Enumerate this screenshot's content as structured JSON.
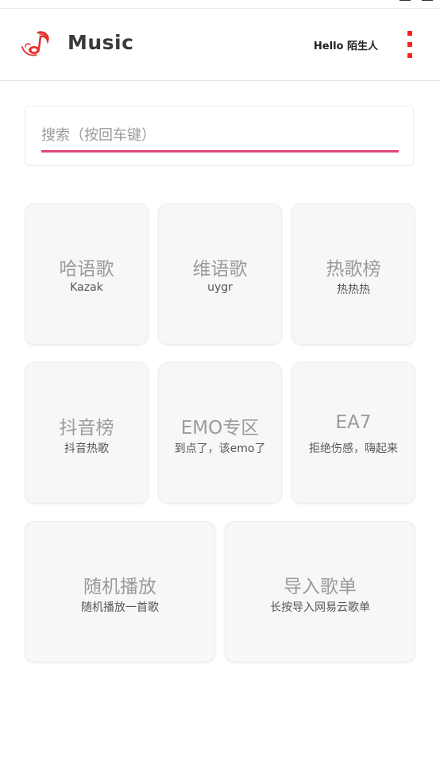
{
  "header": {
    "title": "Music",
    "greeting": "Hello 陌生人",
    "logo_icon": "music-note-icon",
    "menu_icon": "more-vertical-icon",
    "accent_color": "#ff1f1f"
  },
  "search": {
    "placeholder": "搜索（按回车键）",
    "value": "",
    "underline_color": "#e0457a"
  },
  "tiles": [
    {
      "title": "哈语歌",
      "subtitle": "Kazak"
    },
    {
      "title": "维语歌",
      "subtitle": "uygr"
    },
    {
      "title": "热歌榜",
      "subtitle": "热热热"
    },
    {
      "title": "抖音榜",
      "subtitle": "抖音热歌"
    },
    {
      "title": "EMO专区",
      "subtitle": "到点了，该emo了"
    },
    {
      "title": "EA7",
      "subtitle": "拒绝伤感，嗨起来"
    },
    {
      "title": "随机播放",
      "subtitle": "随机播放一首歌"
    },
    {
      "title": "导入歌单",
      "subtitle": "长按导入网易云歌单"
    }
  ]
}
